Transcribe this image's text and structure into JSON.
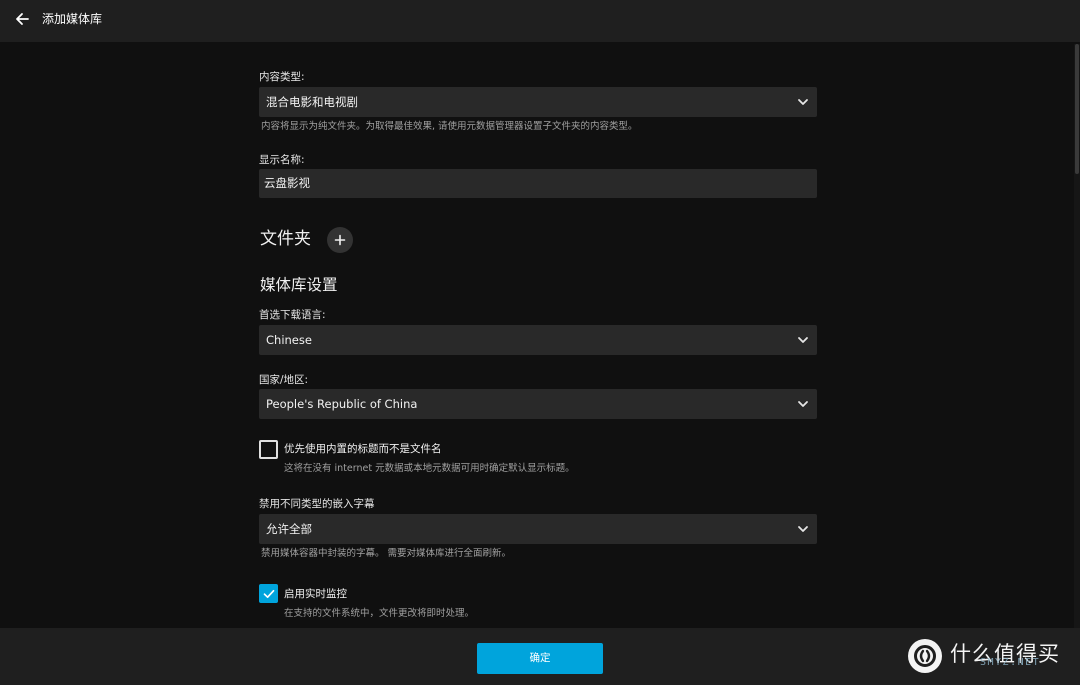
{
  "header": {
    "title": "添加媒体库",
    "back_icon": "arrow-left-icon"
  },
  "form": {
    "content_type": {
      "label": "内容类型:",
      "value": "混合电影和电视剧",
      "hint": "内容将显示为纯文件夹。为取得最佳效果, 请使用元数据管理器设置子文件夹的内容类型。"
    },
    "display_name": {
      "label": "显示名称:",
      "value": "云盘影视"
    },
    "folders": {
      "title": "文件夹",
      "add_icon": "plus-icon"
    },
    "library_settings": {
      "title": "媒体库设置"
    },
    "download_language": {
      "label": "首选下载语言:",
      "value": "Chinese"
    },
    "country": {
      "label": "国家/地区:",
      "value": "People's Republic of China"
    },
    "prefer_embedded_titles": {
      "label": "优先使用内置的标题而不是文件名",
      "hint": "这将在没有 internet 元数据或本地元数据可用时确定默认显示标题。",
      "checked": false
    },
    "embedded_subtitles": {
      "label": "禁用不同类型的嵌入字幕",
      "value": "允许全部",
      "hint": "禁用媒体容器中封装的字幕。 需要对媒体库进行全面刷新。"
    },
    "realtime_monitor": {
      "label": "启用实时监控",
      "hint": "在支持的文件系统中，文件更改将即时处理。",
      "checked": true
    }
  },
  "footer": {
    "ok_label": "确定"
  },
  "watermark": {
    "text": "什么值得买",
    "sub": "SMYZ.NET"
  },
  "colors": {
    "accent": "#00a4dc",
    "background": "#101010",
    "bar": "#1f1f1f",
    "field": "#292929"
  }
}
